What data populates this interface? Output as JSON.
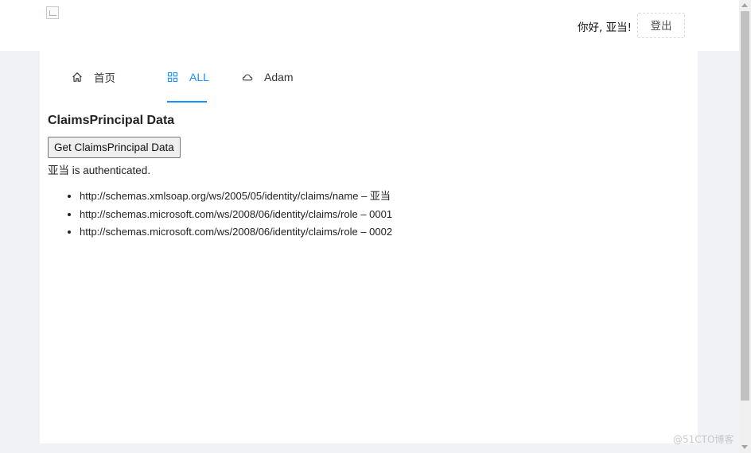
{
  "header": {
    "logo_icon": "broken-image-icon",
    "greeting": "你好, 亚当!",
    "logout_label": "登出"
  },
  "tabs": [
    {
      "label": "首页",
      "icon": "home-icon"
    },
    {
      "label": "ALL",
      "icon": "appstore-icon",
      "active": true
    },
    {
      "label": "Adam",
      "icon": "cloud-icon"
    }
  ],
  "main": {
    "heading": "ClaimsPrincipal Data",
    "button_label": "Get ClaimsPrincipal Data",
    "auth_user": "亚当",
    "auth_suffix": " is authenticated.",
    "claims": [
      {
        "type": "http://schemas.xmlsoap.org/ws/2005/05/identity/claims/name",
        "value": "亚当"
      },
      {
        "type": "http://schemas.microsoft.com/ws/2008/06/identity/claims/role",
        "value": "0001"
      },
      {
        "type": "http://schemas.microsoft.com/ws/2008/06/identity/claims/role",
        "value": "0002"
      }
    ],
    "separator": " – "
  },
  "watermark": "@51CTO博客",
  "colors": {
    "accent": "#1890ff",
    "background": "#f0f2f5",
    "panel": "#ffffff"
  }
}
